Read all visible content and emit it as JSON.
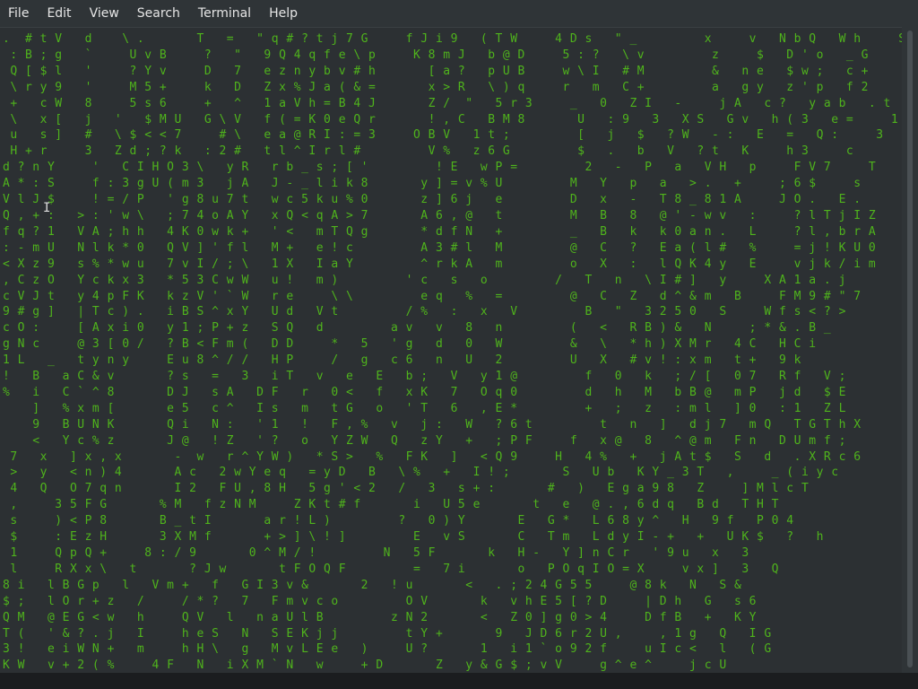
{
  "menu": {
    "items": [
      "File",
      "Edit",
      "View",
      "Search",
      "Terminal",
      "Help"
    ]
  },
  "terminal": {
    "text": ".  # t V   d    \\ .       T   =   \" q # ? t j 7 G     f J i 9   ( T W     4 D s   \" _         x     v   N b Q   W h     S\n : B ; g   `     U v B     ?   \"   9 Q 4 q f e \\ p     K 8 m J   b @ D     5 : ?   \\ v         z     $   D ' o   _ G     M\n Q [ $ l   '     ? Y v     D   7   e z n y b v # h       [ a ?   p U B     w \\ I   # M         &   n e   $ w ;   c +     ^\n \\ r y 9   '     M 5 +     k   D   Z x % J a ( & =       x > R   \\ ) q     r   m   C +         a   g y   z ' p   f 2     $\n +   c W   8     5 s 6     +   ^   1 a V h = B 4 J       Z /  \"   5 r 3     _   0   Z I   -     j A   c ?   y a b   . t     Y\n \\   x [   j   '   $ M U   G \\ V   f ( = K 0 e Q r       ! , C   B M 8       U   : 9   3   X S   G v   h ( 3   e =     1\n u   s ]   #   \\ $ < < 7     # \\   e a @ R I : = 3     O B V   1 t ;         [   j   $   ? W   - :   E   =   Q :     3\n H + r     3   Z d ; ? k   : 2 #   t l ^ I r l #         V %   z 6 G         $   .   b   V   ? t   K     h 3     c\nd ? n Y     '   C I H O 3 \\   y R   r b _ s ; [ '         ! E   w P =         2   -   P   a   V H   p     F V 7     T\nA * : S     f : 3 g U ( m 3   j A   J - _ l i k 8       y ] = v % U         M   Y   p   a   > .   +     ; 6 $     s\nV l J $     ! = / P   ' g 8 u 7 t   w c 5 k u % 0       z ] 6 j   e         D   x   -   T 8 _ 8 1 A     J O .   E .\nQ , + :   > : ' w \\   ; 7 4 o A Y   x Q < q A > 7       A 6 , @   t         M   B   8   @ ' - w v   :     ? l T j I Z\nf q ? 1   V A ; h h   4 K 0 w k +   ' <   m T Q g       * d f N   +         _   B   k   k 0 a n .   L     ? l , b r A\n: - m U   N l k * 0   Q V ] ' f l   M +   e ! c         A 3 # l   M         @   C   ?   E a ( l #   %     = j ! K U 0\n< X z 9   s % * w u   7 v I / ; \\   1 X   I a Y         ^ r k A   m         o   X   :   l Q K 4 y   E     v j k / i m\n, C z O   Y c k x 3   * 5 3 C w W   u !   m )         ' c   s   o         /   T   n   \\ I # ]   y     X A 1 a . j\nc V J t   y 4 p F K   k z V ' ` W   r e     \\ \\         e q   %   =         @   C   Z   d ^ & m   B     F M 9 # \" 7\n9 # g ]   | T c ) .   i B S ^ x Y   U d   V t         / %   :   x   V         B   \"   3 2 5 0   S     W f s < ? >\nc O :     [ A x i 0   y 1 ; P + z   S Q   d         a v   v   8   n         (   <   R B ) &   N     ; * & . B _\ng N c     @ 3 [ 0 /   ? B < F m (   D D     *   5   ' g   d   0   W         &   \\   * h ) X M r   4 C   H C i\n1 L   _   t y n y     E u 8 ^ / /   H P     /   g   c 6   n   U   2         U   X   # v ! : x m   t +   9 k\n!   B   a C & v       ? s   =   3   i T   v   e   E   b ;   V   y 1 @         f   0   k   ; / [   0 7   R f   V ;\n%   i   C ` ^ 8       D J   s A   D F   r   0 <   f   x K   7   O q 0         d   h   M   b B @   m P   j d   $ E\n    ]   % x m [       e 5   c ^   I s   m   t G   o   ' T   6   , E *         +   ;   z   : m l   ] 0   : 1   Z L\n    9   B U N K       Q i   N :   ' 1   !   F , %   v   j :   W   ? 6 t         t   n   ]   d j 7   m Q   T G T h X\n    <   Y c % z       J @   ! Z   ' ?   o   Y Z W   Q   z Y   +   ; P F     f   x @   8   ^ @ m   F n   D U m f ;\n 7   x   ] x , x       -  w   r ^ Y W )   * S >   %   F K   ]   < Q 9     H   4 %   +   j A t $   S   d   . X R c 6\n >   y   < n ) 4       A c   2 w Y e q   = y D   B   \\ %   +   I ! ;       S   U b   K Y _ 3 T   ,     _ ( i y c\n 4   Q   O 7 q n       I 2   F U , 8 H   5 g ' < 2   /   3   s + :       #   )   E g a 9 8   Z     ] M l c T\n ,     3 5 F G       % M   f z N M     Z K t # f       i   U 5 e       t   e   @ . , 6 d q   B d   T H T\n s     ) < P 8       B _ t I       a r ! L )         ?   0 ) Y       E   G *   L 6 8 y ^   H   9 f   P 0 4\n $     : E z H       3 X M f       + > ] \\ ! ]         E   v S       C   T m   L d y I - +   +   U K $   ?   h\n 1     Q p Q +     8 : / 9       0 ^ M / !         N   5 F       k   H -   Y ] n C r   ' 9 u   x   3\n l     R X x \\   t       ? J w       t F O Q F         =   7 i       o   P O q I O = X     v x ]   3   Q\n8 i   l B G p   l   V m +   f   G I 3 v &       2   ! u       <   . ; 2 4 G 5 5     @ 8 k   N   S &\n$ ;   l O r + z   /     / * ?   7   F m v c o         O V       k   v h E 5 [ ? D     | D h   G   s 6\nQ M   @ E G < w   h     Q V   l   n a U l B         z N 2       <   Z 0 ] g 0 > 4     D f B   +   K Y\nT (   ' & ? . j   I     h e S   N   S E K j j         t Y +       9   J D 6 r 2 U ,     , 1 g   Q   I G\n3 !   e i W N +   m     h H \\   g   M v L E e   )     U ?       1   i 1 ` o 9 2 f     u I c <   l   ( G\nK W   v + 2 ( %     4 F   N   i X M ` N   w     + D       Z   y & G $ ; v V     g ^ e ^     j c U"
  },
  "colors": {
    "menu_bg": "#2f3437",
    "terminal_bg": "#2c3033",
    "matrix_green": "#4fb31c"
  }
}
